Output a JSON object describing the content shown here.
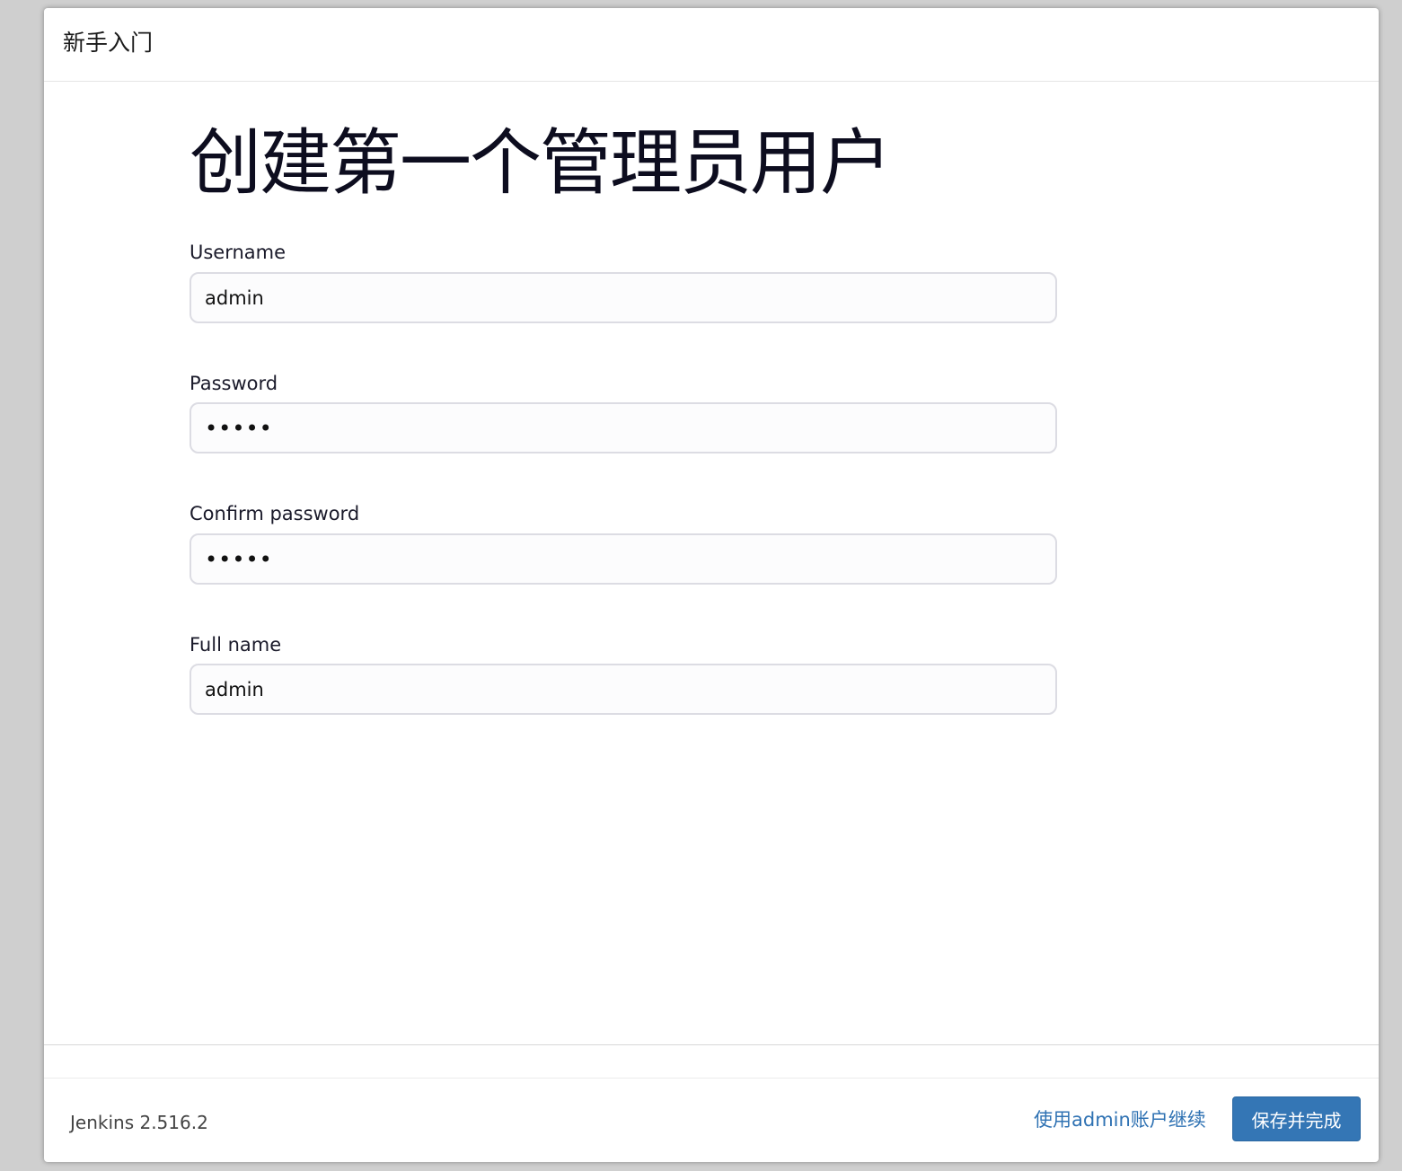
{
  "dialog": {
    "title": "新手入门"
  },
  "form": {
    "heading": "创建第一个管理员用户",
    "fields": [
      {
        "label": "Username",
        "value": "admin",
        "type": "text"
      },
      {
        "label": "Password",
        "value": "admin",
        "type": "password"
      },
      {
        "label": "Confirm password",
        "value": "admin",
        "type": "password"
      },
      {
        "label": "Full name",
        "value": "admin",
        "type": "text"
      }
    ]
  },
  "footer": {
    "version": "Jenkins 2.516.2",
    "skip_link": "使用admin账户继续",
    "save_button": "保存并完成"
  },
  "colors": {
    "accent": "#3476b5",
    "link": "#2f72b3"
  }
}
